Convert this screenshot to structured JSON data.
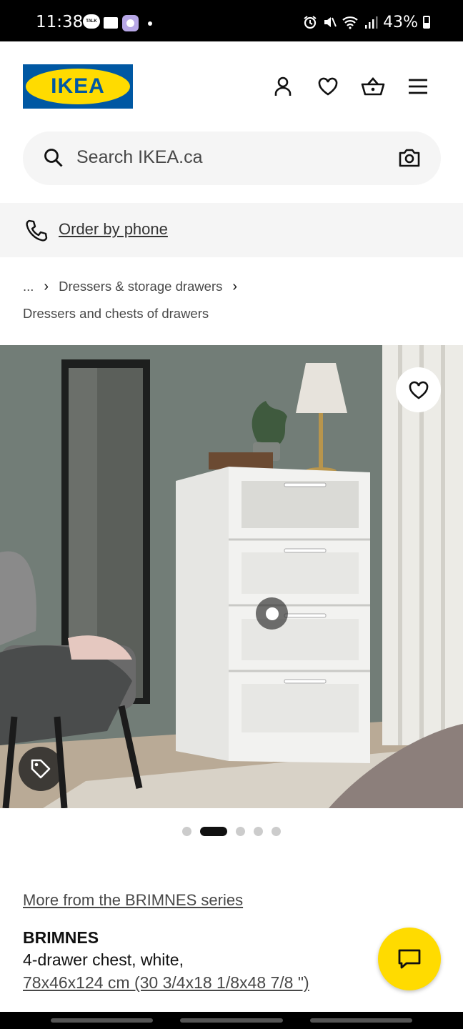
{
  "status_bar": {
    "time": "11:38",
    "talk_icon_text": "TALK",
    "battery": "43%"
  },
  "header": {
    "logo_text": "IKEA",
    "brand_colors": {
      "blue": "#0058a3",
      "yellow": "#ffdb00"
    },
    "icons": [
      "account-icon",
      "wishlist-heart-icon",
      "basket-icon",
      "menu-icon"
    ]
  },
  "search": {
    "placeholder": "Search IKEA.ca"
  },
  "order_phone": {
    "label": "Order by phone"
  },
  "breadcrumb": {
    "ellipsis": "...",
    "sep": "›",
    "items": [
      "Dressers & storage drawers",
      "Dressers and chests of drawers"
    ]
  },
  "carousel": {
    "total": 5,
    "active_index": 1
  },
  "product": {
    "series_link": "More from the BRIMNES series",
    "name": "BRIMNES",
    "description": "4-drawer chest, white,",
    "size": "78x46x124 cm (30 3/4x18 1/8x48 7/8 \")"
  }
}
